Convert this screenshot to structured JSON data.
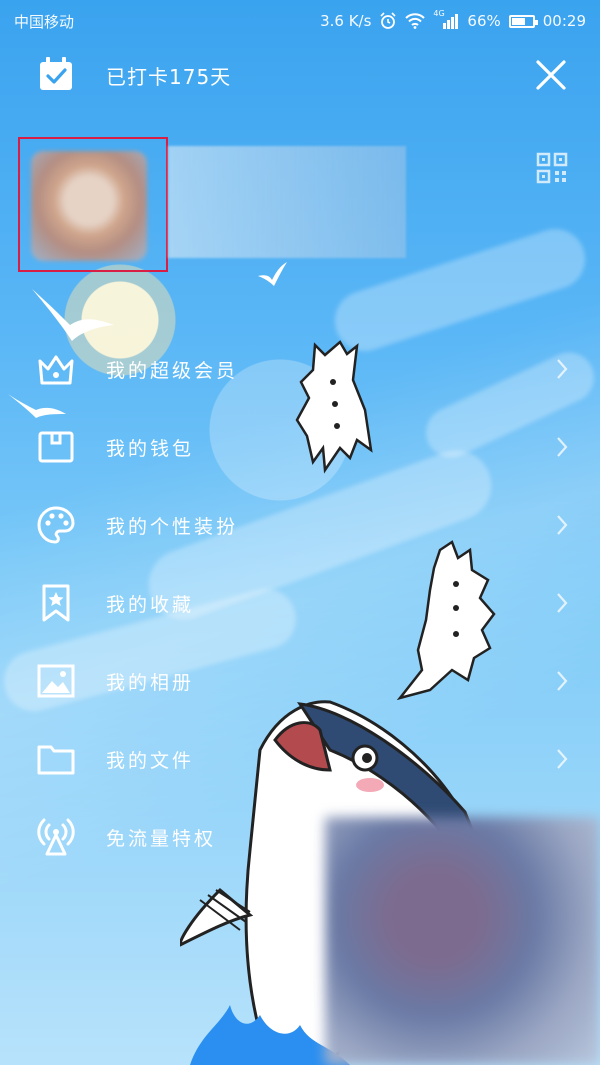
{
  "status_bar": {
    "carrier": "中国移动",
    "network_speed": "3.6 K/s",
    "signal_label": "4G",
    "battery": "66%",
    "battery_level": 0.66,
    "time": "00:29"
  },
  "header": {
    "checkin_text": "已打卡175天",
    "close_icon": "close-icon",
    "calendar_icon": "calendar-check-icon"
  },
  "profile": {
    "qr_icon": "qr-code-icon",
    "highlight_color": "#d81e45"
  },
  "menu": {
    "items": [
      {
        "label": "我的超级会员",
        "icon": "crown-icon"
      },
      {
        "label": "我的钱包",
        "icon": "wallet-icon"
      },
      {
        "label": "我的个性装扮",
        "icon": "palette-icon"
      },
      {
        "label": "我的收藏",
        "icon": "bookmark-star-icon"
      },
      {
        "label": "我的相册",
        "icon": "photo-album-icon"
      },
      {
        "label": "我的文件",
        "icon": "folder-icon"
      },
      {
        "label": "免流量特权",
        "icon": "antenna-icon"
      }
    ]
  },
  "colors": {
    "sky_top": "#3aa3ef",
    "sky_bottom": "#b7e2fb",
    "text": "#ffffff"
  }
}
